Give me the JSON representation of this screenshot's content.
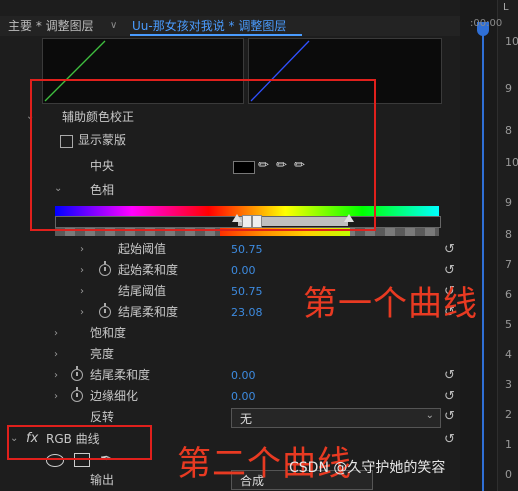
{
  "tabs": {
    "primary": "主要 * 调整图层",
    "separator": "∨",
    "secondary": "Uu-那女孩对我说 * 调整图层"
  },
  "timeline": {
    "timecode": ":00:00",
    "ruler_numbers": [
      "10",
      "9",
      "8",
      "10",
      "9",
      "8",
      "7",
      "6",
      "5",
      "4",
      "3",
      "2",
      "1",
      "0"
    ]
  },
  "section": {
    "title": "辅助颜色校正",
    "show_mask": "显示蒙版",
    "center_label": "中央",
    "hue_label": "色相"
  },
  "params": [
    {
      "label": "起始阈值",
      "value": "50.75",
      "timer": false
    },
    {
      "label": "起始柔和度",
      "value": "0.00",
      "timer": true
    },
    {
      "label": "结尾阈值",
      "value": "50.75",
      "timer": false
    },
    {
      "label": "结尾柔和度",
      "value": "23.08",
      "timer": true
    }
  ],
  "more_params": [
    {
      "label": "饱和度",
      "value": "",
      "timer": false
    },
    {
      "label": "亮度",
      "value": "",
      "timer": false
    },
    {
      "label": "结尾柔和度",
      "value": "0.00",
      "timer": true
    },
    {
      "label": "边缘细化",
      "value": "0.00",
      "timer": true
    }
  ],
  "invert": {
    "label": "反转",
    "value": "无"
  },
  "curves": {
    "fx": "fx",
    "title": "RGB 曲线",
    "output_label": "输出",
    "output_value": "合成"
  },
  "annotations": {
    "first": "第一个曲线",
    "second": "第二个曲线"
  },
  "watermark": "CSDN @久守护她的笑容",
  "colors": {
    "accent": "#4a9cff",
    "value_blue": "#3d8be0",
    "annotation_red": "#e0201c"
  }
}
